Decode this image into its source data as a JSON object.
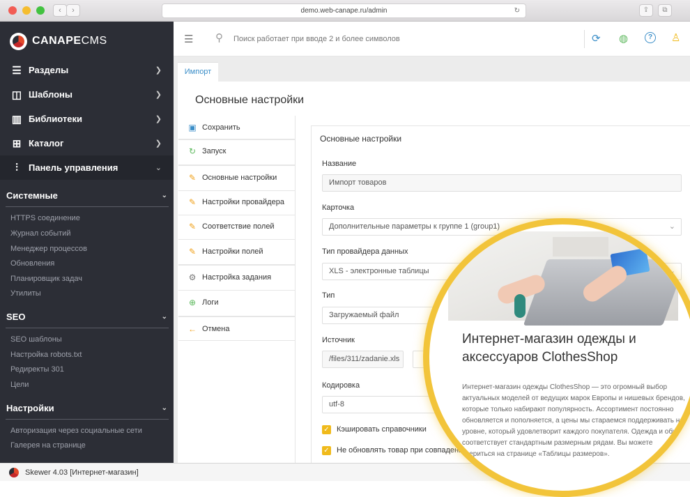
{
  "browser": {
    "url": "demo.web-canape.ru/admin"
  },
  "brand": {
    "name_bold": "CANAPE",
    "name_light": "CMS"
  },
  "sidebar": {
    "menu": [
      {
        "label": "Разделы",
        "icon": "list-icon"
      },
      {
        "label": "Шаблоны",
        "icon": "layout-icon"
      },
      {
        "label": "Библиотеки",
        "icon": "book-icon"
      },
      {
        "label": "Каталог",
        "icon": "grid-icon"
      },
      {
        "label": "Панель управления",
        "icon": "sliders-icon"
      }
    ],
    "sections": [
      {
        "title": "Системные",
        "items": [
          "HTTPS соединение",
          "Журнал событий",
          "Менеджер процессов",
          "Обновления",
          "Планировщик задач",
          "Утилиты"
        ]
      },
      {
        "title": "SEO",
        "items": [
          "SEO шаблоны",
          "Настройка robots.txt",
          "Редиректы 301",
          "Цели"
        ]
      },
      {
        "title": "Настройки",
        "items": [
          "Авторизация через социальные сети",
          "Галерея на странице"
        ]
      }
    ]
  },
  "topbar": {
    "search_placeholder": "Поиск работает при вводе 2 и более символов"
  },
  "tab": {
    "label": "Импорт"
  },
  "page": {
    "title": "Основные настройки"
  },
  "leftnav": [
    {
      "label": "Сохранить",
      "icon": "floppy-icon"
    },
    {
      "label": "Запуск",
      "icon": "refresh-icon"
    },
    {
      "label": "Основные настройки",
      "icon": "pencil-icon"
    },
    {
      "label": "Настройки провайдера",
      "icon": "pencil-icon"
    },
    {
      "label": "Соответствие полей",
      "icon": "pencil-icon"
    },
    {
      "label": "Настройки полей",
      "icon": "pencil-icon"
    },
    {
      "label": "Настройка задания",
      "icon": "gear-icon"
    },
    {
      "label": "Логи",
      "icon": "plus-circle-icon"
    },
    {
      "label": "Отмена",
      "icon": "arrow-left-icon"
    }
  ],
  "form": {
    "heading": "Основные настройки",
    "fields": {
      "name": {
        "label": "Название",
        "value": "Импорт товаров"
      },
      "card": {
        "label": "Карточка",
        "value": "Дополнительные параметры к группе 1 (group1)"
      },
      "provider": {
        "label": "Тип провайдера данных",
        "value": "XLS - электронные таблицы"
      },
      "type": {
        "label": "Тип",
        "value": "Загружаемый файл"
      },
      "source": {
        "label": "Источник",
        "value": "/files/311/zadanie.xls"
      },
      "encoding": {
        "label": "Кодировка",
        "value": "utf-8"
      }
    },
    "checkboxes": [
      {
        "label": "Кэшировать справочники"
      },
      {
        "label": "Не обновлять товар при совпадении хэш..."
      }
    ]
  },
  "statusbar": {
    "text": "Skewer 4.03 [Интернет-магазин]"
  },
  "preview": {
    "title": "Интернет-магазин одежды и аксессуаров ClothesShop",
    "text": "Интернет-магазин одежды ClothesShop — это огромный выбор актуальных моделей от ведущих марок Европы и нишевых брендов, которые только набирают популярность. Ассортимент постоянно обновляется и пополняется, а цены мы стараемся поддерживать на уровне, который удовлетворит каждого покупателя. Одежда и обувь соответствует стандартным размерным рядам. Вы можете свериться на странице «Таблицы размеров»."
  },
  "colors": {
    "sidebar_bg": "#2c2e36",
    "accent": "#f2c43a",
    "link": "#3b8ec8",
    "checkbox": "#f0ba1b"
  }
}
